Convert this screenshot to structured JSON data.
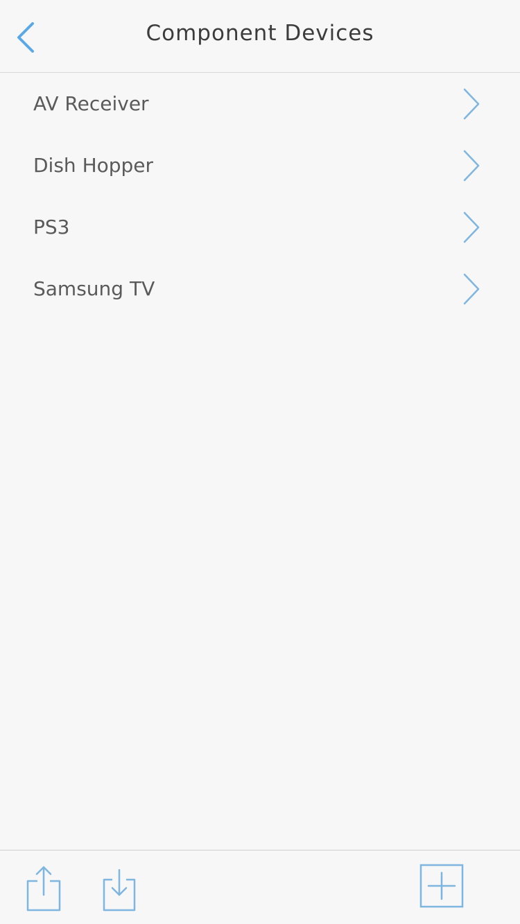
{
  "navbar": {
    "title": "Component Devices",
    "back_icon": "chevron-left-icon"
  },
  "devices": [
    {
      "label": "AV Receiver"
    },
    {
      "label": "Dish Hopper"
    },
    {
      "label": "PS3"
    },
    {
      "label": "Samsung TV"
    }
  ],
  "toolbar": {
    "export_icon": "share-icon",
    "import_icon": "import-icon",
    "add_icon": "add-icon"
  },
  "colors": {
    "accent": "#5aa9e6",
    "title_text": "#3c3c3c",
    "row_text": "#5a5a5a",
    "background": "#f7f7f7"
  }
}
